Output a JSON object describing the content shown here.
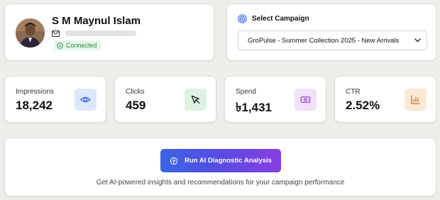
{
  "profile": {
    "name": "S M Maynul Islam",
    "status": "Connected",
    "icons": {
      "email": "mail-icon",
      "status": "check-circle-icon"
    }
  },
  "campaign": {
    "title": "Select Campaign",
    "selected": "GroPulse - Summer Collection 2025 - New Arrivals",
    "icons": {
      "title": "target-icon",
      "dropdown": "chevron-down-icon"
    }
  },
  "metrics": [
    {
      "label": "Impressions",
      "value": "18,242",
      "icon": "eye-icon",
      "icon_bg": "#dce7fb",
      "icon_color": "#3c6ad6"
    },
    {
      "label": "Clicks",
      "value": "459",
      "icon": "cursor-icon",
      "icon_bg": "#dcf3e4",
      "icon_color": "#1f1f1f"
    },
    {
      "label": "Spend",
      "value": "৳1,431",
      "icon": "banknote-icon",
      "icon_bg": "#f1e0f8",
      "icon_color": "#9b3fd0"
    },
    {
      "label": "CTR",
      "value": "2.52%",
      "icon": "bar-chart-icon",
      "icon_bg": "#fbe8d6",
      "icon_color": "#c9741e"
    }
  ],
  "analysis": {
    "button_label": "Run AI Diagnostic Analysis",
    "button_icon": "brain-icon",
    "subtext": "Get AI-powered insights and recommendations for your campaign performance"
  },
  "colors": {
    "background": "#efeeea",
    "button_gradient_start": "#3a63e6",
    "button_gradient_end": "#8a3fe0",
    "success": "#2f8a45"
  }
}
